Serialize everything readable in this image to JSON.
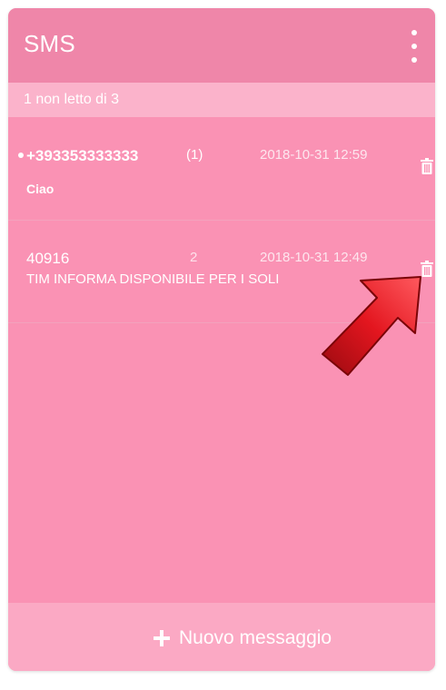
{
  "header": {
    "title": "SMS",
    "menu_icon": "vertical-dots-icon"
  },
  "subheader": {
    "unread_summary": "1 non letto di  3"
  },
  "messages": [
    {
      "sender": "+393353333333",
      "count": "(1)",
      "time": "2018-10-31 12:59",
      "preview": "Ciao",
      "unread": true
    },
    {
      "sender": "40916",
      "count": "2",
      "time": "2018-10-31 12:49",
      "preview": "TIM INFORMA DISPONIBILE PER I SOLI",
      "unread": false
    }
  ],
  "footer": {
    "new_message_label": "Nuovo messaggio"
  },
  "colors": {
    "card": "#fa92b4",
    "header": "#ef86a9",
    "subheader": "#fbb3cb",
    "footer": "#fba9c4",
    "arrow": "#d8101a"
  },
  "icons": {
    "delete": "trash-icon",
    "add": "plus-icon",
    "pointer": "red-arrow-icon"
  }
}
